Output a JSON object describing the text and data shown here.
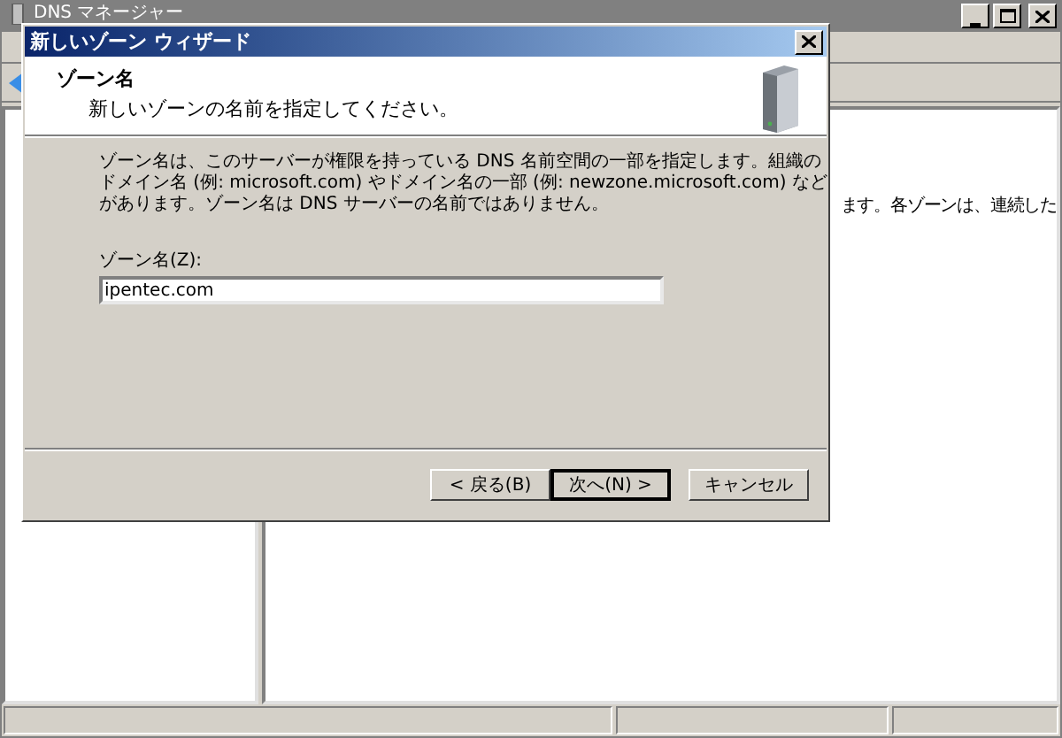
{
  "main_window": {
    "title": "DNS マネージャー",
    "content_text": "ます。各ゾーンは、連続した"
  },
  "dialog": {
    "title": "新しいゾーン ウィザード",
    "header_title": "ゾーン名",
    "header_subtitle": "新しいゾーンの名前を指定してください。",
    "description": "ゾーン名は、このサーバーが権限を持っている DNS 名前空間の一部を指定します。組織のドメイン名 (例: microsoft.com) やドメイン名の一部 (例: newzone.microsoft.com) などがあります。ゾーン名は DNS サーバーの名前ではありません。",
    "field": {
      "label": "ゾーン名(Z):",
      "value": "ipentec.com"
    },
    "buttons": [
      {
        "label": "< 戻る(B)",
        "default": false
      },
      {
        "label": "次へ(N) >",
        "default": true
      },
      {
        "label": "キャンセル",
        "default": false
      }
    ]
  }
}
